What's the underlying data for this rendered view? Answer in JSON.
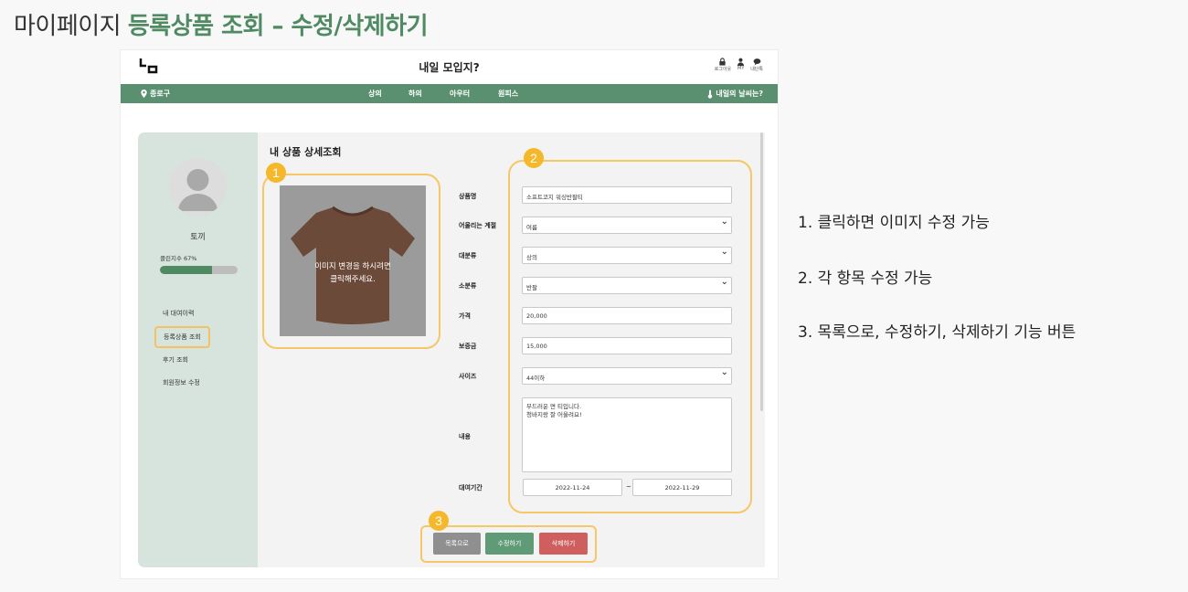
{
  "page_heading": {
    "prefix": "마이페이지",
    "highlight": "등록상품 조회 – 수정/삭제하기"
  },
  "header": {
    "site_title": "내일 모입지?",
    "icons": [
      {
        "icon": "lock-icon",
        "label": "로그아웃"
      },
      {
        "icon": "user-icon",
        "label": "MY"
      },
      {
        "icon": "chat-icon",
        "label": "내단톡"
      }
    ]
  },
  "nav": {
    "location": "종로구",
    "menu": [
      "상의",
      "하의",
      "아우터",
      "원피스"
    ],
    "weather_link": "내일의 날씨는?"
  },
  "sidebar": {
    "user_name": "토끼",
    "clean_label": "클린지수 67%",
    "clean_percent": 67,
    "items": [
      "내 대여이력",
      "등록상품 조회",
      "후기 조회",
      "회원정보 수정"
    ],
    "active_index": 1
  },
  "content": {
    "title": "내 상품 상세조회",
    "image_hint_line1": "이미지 변경을 하시려면",
    "image_hint_line2": "클릭해주세요."
  },
  "form": {
    "product_name": {
      "label": "상품명",
      "value": "소프트코지 워싱반팔티"
    },
    "season": {
      "label": "어울리는 계절",
      "value": "여름"
    },
    "category": {
      "label": "대분류",
      "value": "상의"
    },
    "subcategory": {
      "label": "소분류",
      "value": "반팔"
    },
    "price": {
      "label": "가격",
      "value": "20,000"
    },
    "deposit": {
      "label": "보증금",
      "value": "15,000"
    },
    "size": {
      "label": "사이즈",
      "value": "44이하"
    },
    "description": {
      "label": "내용",
      "line1": "부드러운 면 티입니다.",
      "line2": "청바지랑 잘 어울려요!"
    },
    "rental_period": {
      "label": "대여기간",
      "start": "2022-11-24",
      "separator": "~",
      "end": "2022-11-29"
    }
  },
  "buttons": {
    "list": "목록으로",
    "edit": "수정하기",
    "delete": "삭제하기"
  },
  "callouts": [
    "1",
    "2",
    "3"
  ],
  "notes": [
    "1.  클릭하면 이미지 수정 가능",
    "2. 각 항목 수정 가능",
    "3. 목록으로, 수정하기, 삭제하기 기능 버튼"
  ],
  "colors": {
    "brand_green": "#5a9070",
    "callout": "#f5b82a",
    "delete_red": "#cf5f5f",
    "shirt_brown": "#6b4a3a"
  }
}
